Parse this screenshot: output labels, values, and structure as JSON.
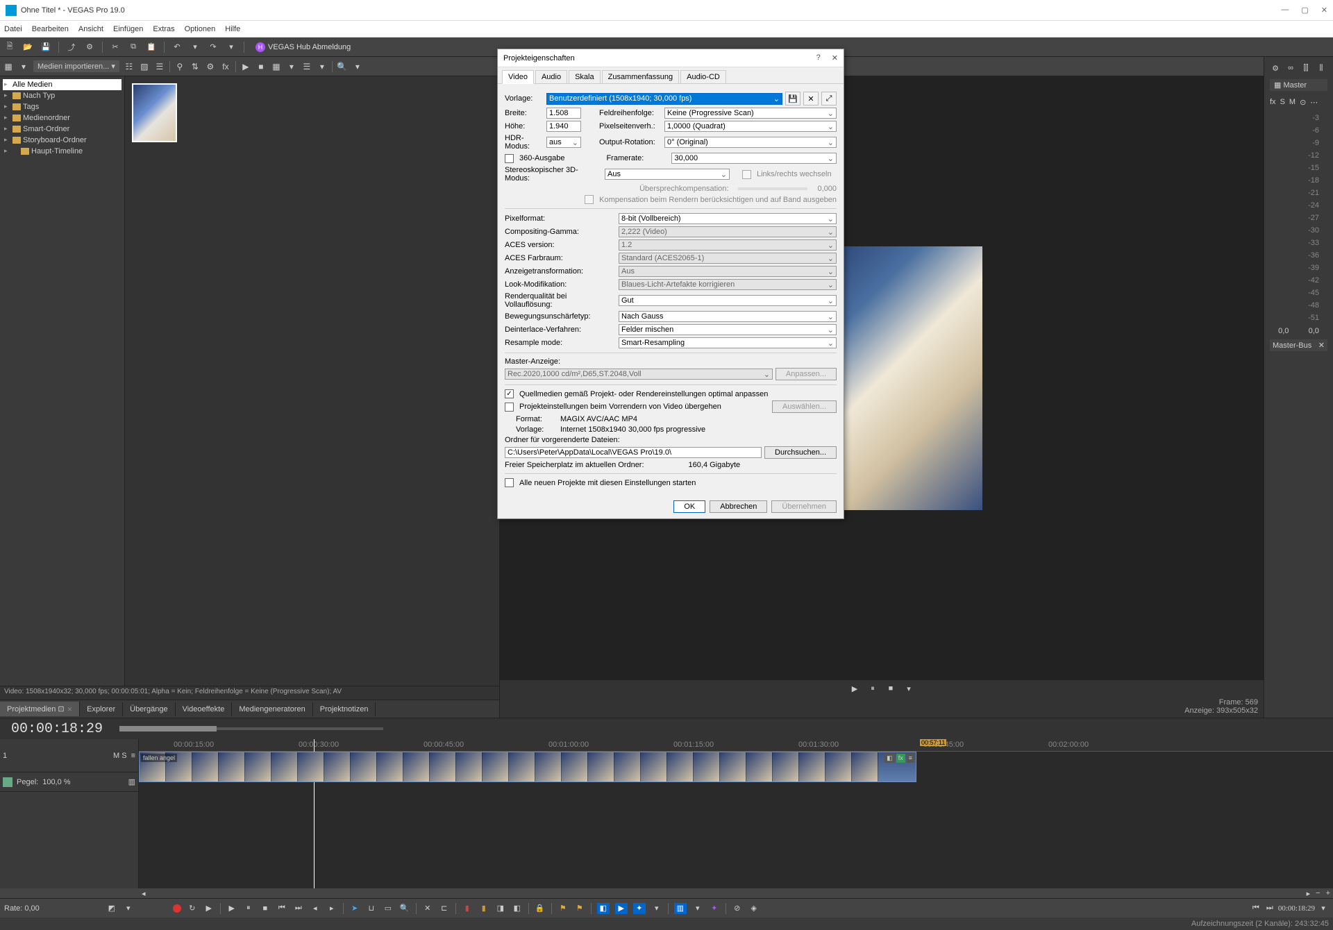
{
  "titlebar": {
    "title": "Ohne Titel * - VEGAS Pro 19.0"
  },
  "menubar": [
    "Datei",
    "Bearbeiten",
    "Ansicht",
    "Einfügen",
    "Extras",
    "Optionen",
    "Hilfe"
  ],
  "hub": "VEGAS Hub Abmeldung",
  "mediaimport": "Medien importieren...",
  "tree": {
    "items": [
      "Alle Medien",
      "Nach Typ",
      "Tags",
      "Medienordner",
      "Smart-Ordner",
      "Storyboard-Ordner",
      "Haupt-Timeline"
    ],
    "selected": 0
  },
  "mediainfo": "Video: 1508x1940x32; 30,000 fps; 00:00:05:01; Alpha = Kein; Feldreihenfolge = Keine (Progressive Scan); AV",
  "tabs": [
    "Projektmedien",
    "Explorer",
    "Übergänge",
    "Videoeffekte",
    "Mediengeneratoren",
    "Projektnotizen"
  ],
  "preview": {
    "frame_label": "Frame:",
    "frame": "569",
    "display_label": "Anzeige:",
    "display": "393x505x32"
  },
  "master_label": "Master",
  "master_bus": "Master-Bus",
  "meter_vals": [
    "0,0",
    "0,0"
  ],
  "scale": [
    "-3",
    "-6",
    "-9",
    "-12",
    "-15",
    "-18",
    "-21",
    "-24",
    "-27",
    "-30",
    "-33",
    "-36",
    "-39",
    "-42",
    "-45",
    "-48",
    "-51"
  ],
  "timecode": "00:00:18:29",
  "track": {
    "pegel_label": "Pegel:",
    "pegel": "100,0 %",
    "ms": "M  S"
  },
  "clip_label": "fallen angel",
  "ruler": [
    "00:00:15:00",
    "00:00:30:00",
    "00:00:45:00",
    "00:01:00:00",
    "00:01:15:00",
    "00:01:30:00",
    "00:01:45:00",
    "00:02:00:00"
  ],
  "region": "00:57:11",
  "rate": "Rate: 0,00",
  "bottom_time": "00:00:18:29",
  "status": "Aufzeichnungszeit (2 Kanäle): 243:32:45",
  "dialog": {
    "title": "Projekteigenschaften",
    "tabs": [
      "Video",
      "Audio",
      "Skala",
      "Zusammenfassung",
      "Audio-CD"
    ],
    "template_label": "Vorlage:",
    "template_value": "Benutzerdefiniert (1508x1940; 30,000 fps)",
    "width_label": "Breite:",
    "width": "1.508",
    "height_label": "Höhe:",
    "height": "1.940",
    "hdr_label": "HDR-Modus:",
    "hdr": "aus",
    "out360": "360-Ausgabe",
    "field_label": "Feldreihenfolge:",
    "field": "Keine (Progressive Scan)",
    "par_label": "Pixelseitenverh.:",
    "par": "1,0000 (Quadrat)",
    "rot_label": "Output-Rotation:",
    "rot": "0° (Original)",
    "fr_label": "Framerate:",
    "fr": "30,000",
    "stereo_label": "Stereoskopischer 3D-Modus:",
    "stereo": "Aus",
    "swap": "Links/rechts wechseln",
    "crosstalk_label": "Übersprechkompensation:",
    "crosstalk": "0,000",
    "comp_render": "Kompensation beim Rendern berücksichtigen und auf Band ausgeben",
    "pixfmt_label": "Pixelformat:",
    "pixfmt": "8-bit (Vollbereich)",
    "gamma_label": "Compositing-Gamma:",
    "gamma": "2,222 (Video)",
    "aces_label": "ACES version:",
    "aces": "1.2",
    "acescs_label": "ACES Farbraum:",
    "acescs": "Standard (ACES2065-1)",
    "view_label": "Anzeigetransformation:",
    "view": "Aus",
    "look_label": "Look-Modifikation:",
    "look": "Blaues-Licht-Artefakte korrigieren",
    "rq_label": "Renderqualität bei Vollauflösung:",
    "rq": "Gut",
    "mb_label": "Bewegungsunschärfetyp:",
    "mb": "Nach Gauss",
    "di_label": "Deinterlace-Verfahren:",
    "di": "Felder mischen",
    "rs_label": "Resample mode:",
    "rs": "Smart-Resampling",
    "master_disp_label": "Master-Anzeige:",
    "master_disp": "Rec.2020,1000 cd/m²,D65,ST.2048,Voll",
    "adjust": "Anpassen...",
    "adapt_src": "Quellmedien gemäß Projekt- oder Rendereinstellungen optimal anpassen",
    "prerender": "Projekteinstellungen beim Vorrendern von Video übergehen",
    "select_btn": "Auswählen...",
    "format_label": "Format:",
    "format": "MAGIX AVC/AAC MP4",
    "preset_label": "Vorlage:",
    "preset": "Internet 1508x1940 30,000 fps progressive",
    "folder_label": "Ordner für vorgerenderte Dateien:",
    "folder": "C:\\Users\\Peter\\AppData\\Local\\VEGAS Pro\\19.0\\",
    "browse": "Durchsuchen...",
    "free_label": "Freier Speicherplatz im aktuellen Ordner:",
    "free": "160,4 Gigabyte",
    "allnew": "Alle neuen Projekte mit diesen Einstellungen starten",
    "ok": "OK",
    "cancel": "Abbrechen",
    "apply": "Übernehmen"
  }
}
